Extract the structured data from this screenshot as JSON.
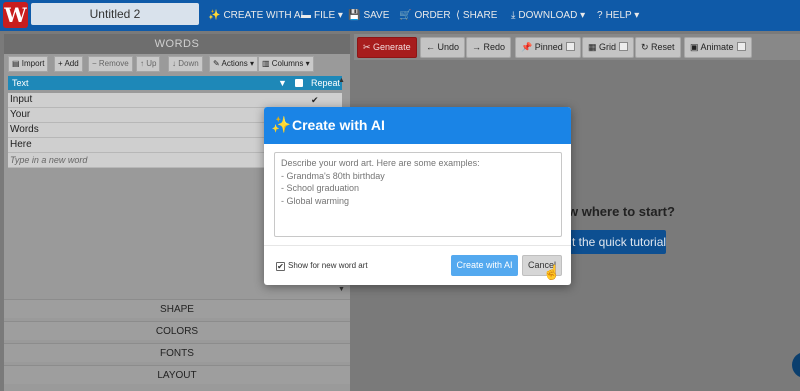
{
  "app": {
    "logo_letter": "W",
    "document_title": "Untitled 2"
  },
  "nav": [
    {
      "icon": "✨",
      "label": "CREATE WITH AI"
    },
    {
      "icon": "▬",
      "label": "FILE ▾"
    },
    {
      "icon": "💾",
      "label": "SAVE"
    },
    {
      "icon": "🛒",
      "label": "ORDER"
    },
    {
      "icon": "⟨",
      "label": "SHARE"
    },
    {
      "icon": "⤓",
      "label": "DOWNLOAD ▾"
    },
    {
      "icon": "?",
      "label": "HELP ▾"
    }
  ],
  "words_panel": {
    "header": "WORDS",
    "toolbar": {
      "import": "Import",
      "add": "Add",
      "remove": "Remove",
      "up": "Up",
      "down": "Down",
      "actions": "Actions ▾",
      "columns": "Columns ▾"
    },
    "columns": {
      "text": "Text",
      "repeat": "Repeat"
    },
    "rows": [
      "Input",
      "Your",
      "Words",
      "Here"
    ],
    "new_word_placeholder": "Type in a new word"
  },
  "sections": [
    "SHAPE",
    "COLORS",
    "FONTS",
    "LAYOUT"
  ],
  "canvas_toolbar": {
    "generate": "Generate",
    "undo": "Undo",
    "redo": "Redo",
    "pinned": "Pinned",
    "grid": "Grid",
    "reset": "Reset",
    "animate": "Animate"
  },
  "canvas": {
    "hint_text": "w where to start?",
    "tutorial_button": "t the quick tutorial"
  },
  "modal": {
    "title": "Create with AI",
    "prompt_placeholder": "Describe your word art. Here are some examples:\n- Grandma's 80th birthday\n- School graduation\n- Global warming",
    "show_for_new": "Show for new word art",
    "show_for_new_checked": true,
    "create_button": "Create with AI",
    "cancel_button": "Cancel"
  }
}
